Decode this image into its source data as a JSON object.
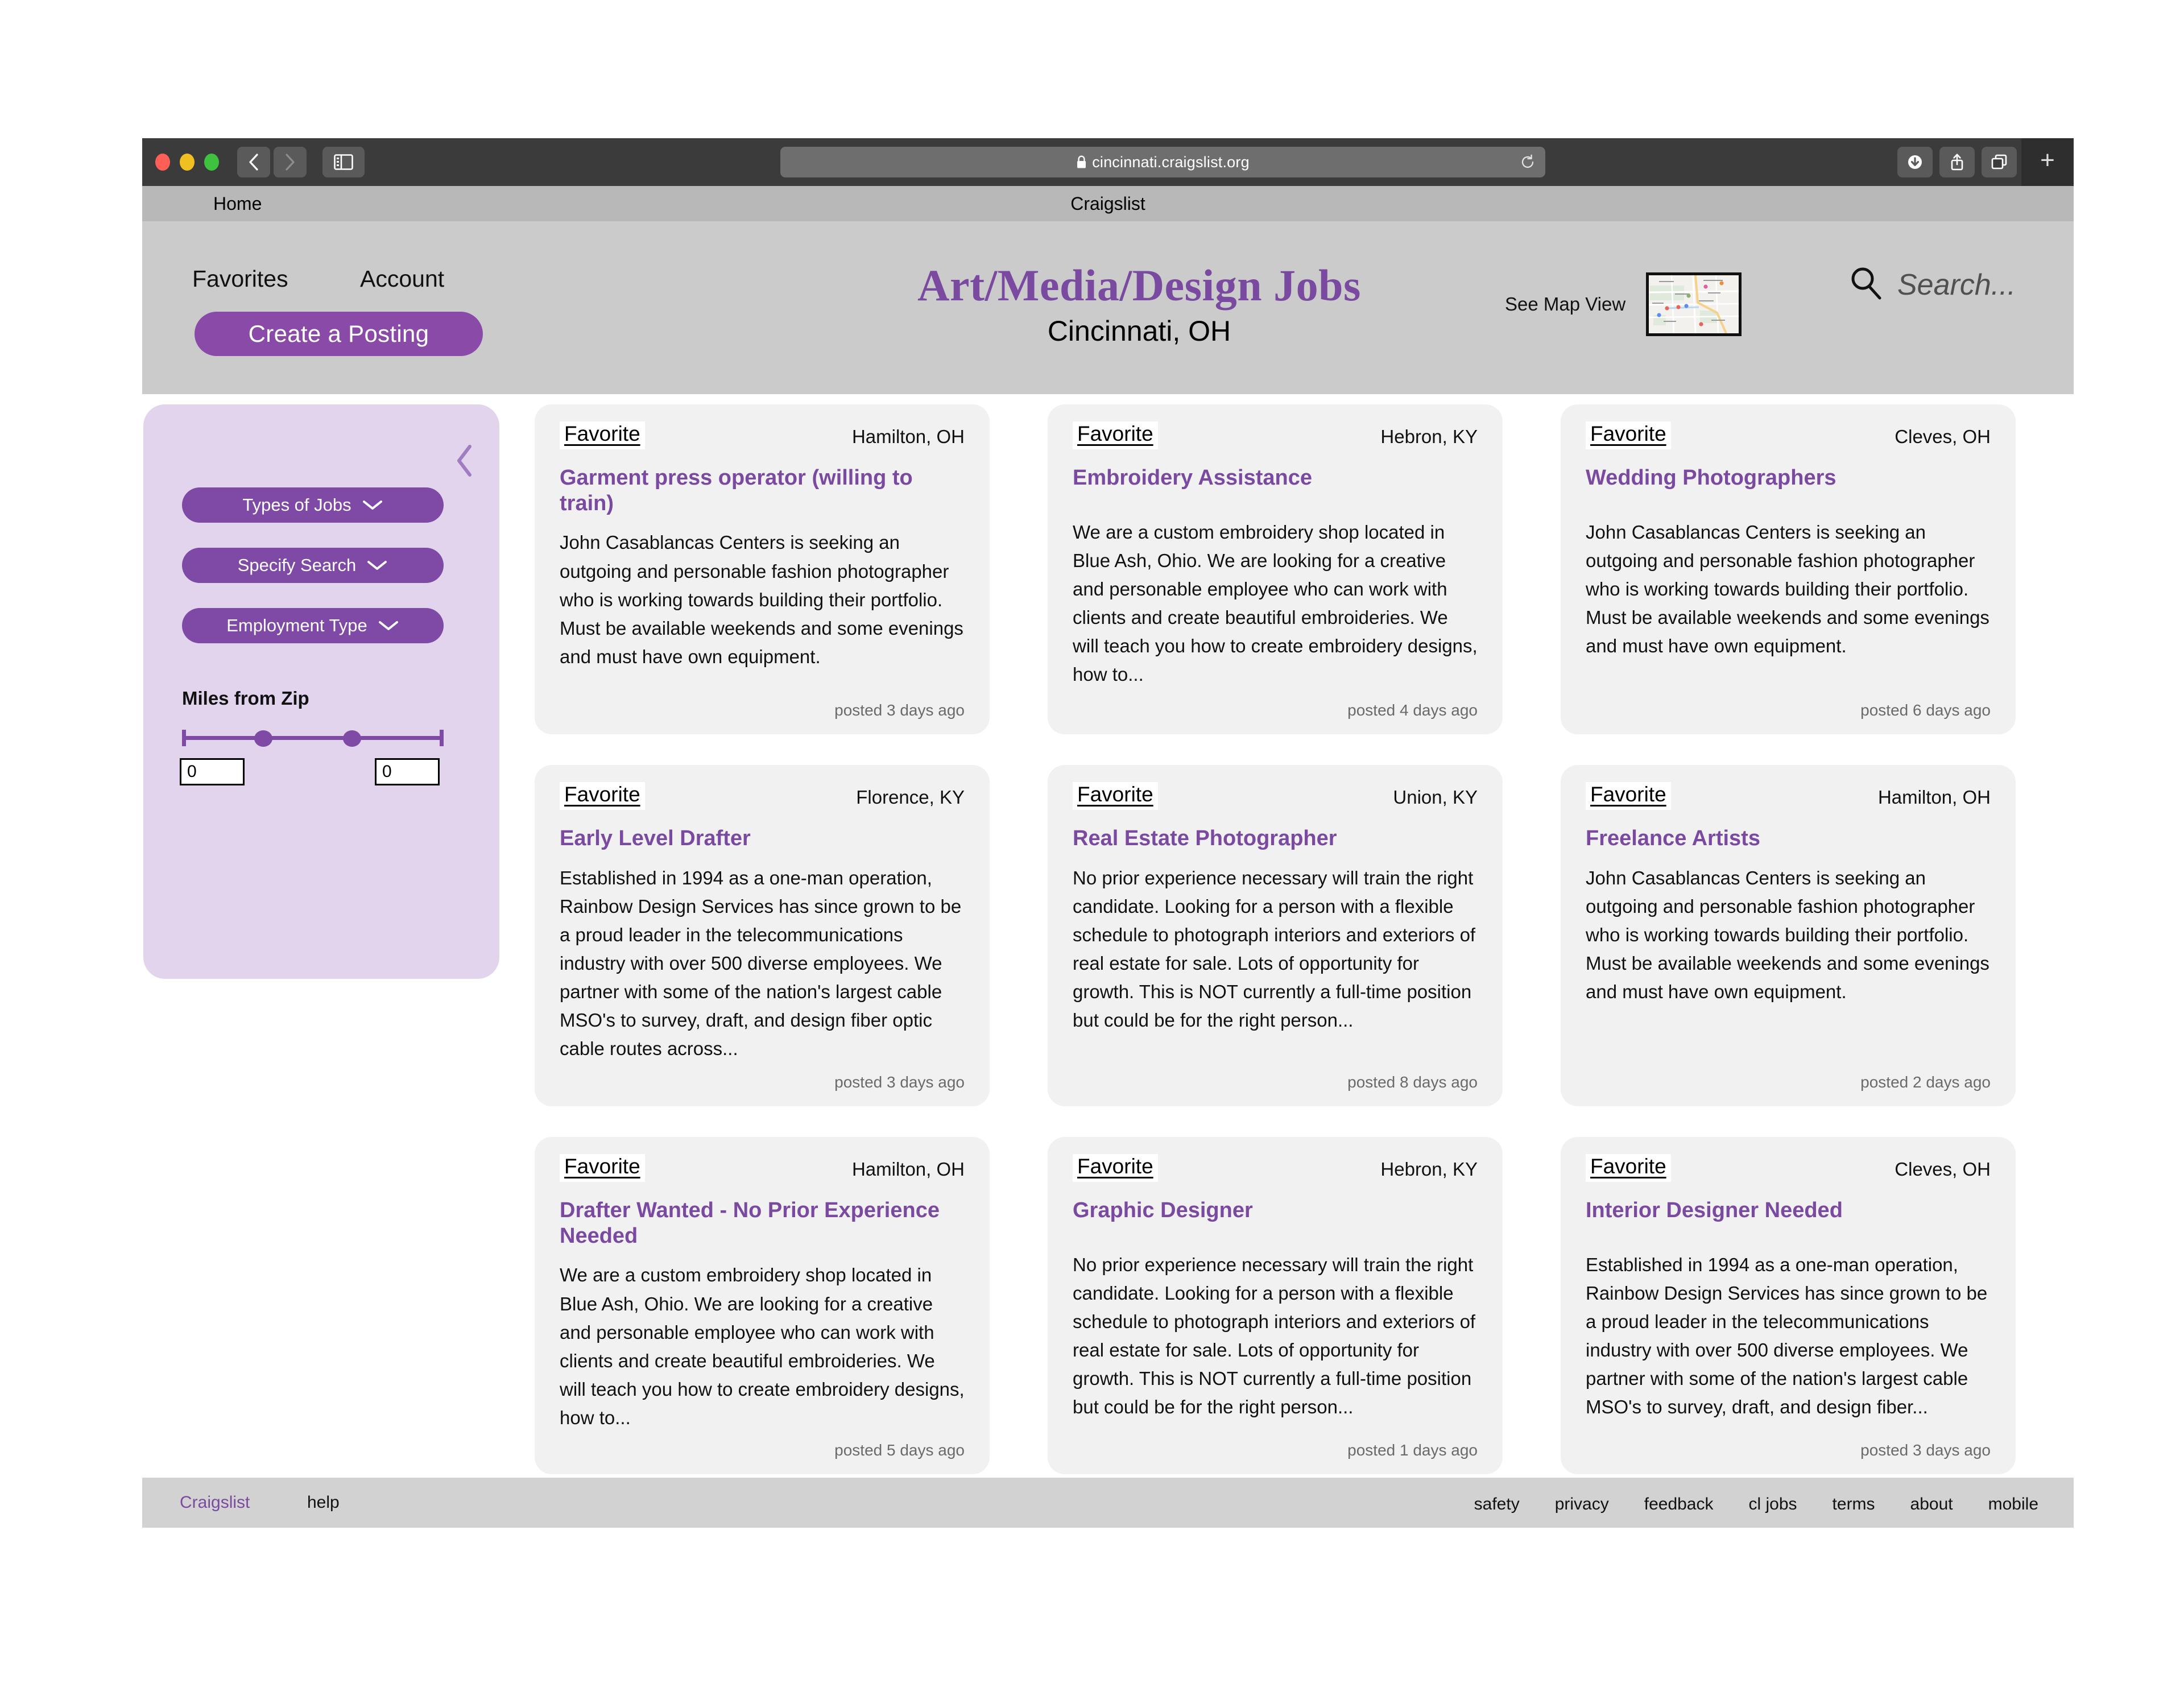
{
  "browser": {
    "url": "cincinnati.craigslist.org",
    "lock_icon": "lock-icon",
    "reload_icon": "reload-icon",
    "back_icon": "chevron-left-icon",
    "forward_icon": "chevron-right-icon",
    "sidebar_icon": "sidebar-toggle-icon",
    "downloads_icon": "download-icon",
    "share_icon": "share-icon",
    "tabs_icon": "tab-overview-icon",
    "new_tab_label": "+"
  },
  "tabbar": {
    "home_label": "Home",
    "active_tab_title": "Craigslist"
  },
  "header": {
    "nav": {
      "favorites": "Favorites",
      "account": "Account"
    },
    "create_posting_label": "Create a Posting",
    "title": "Art/Media/Design Jobs",
    "subtitle": "Cincinnati, OH",
    "map_view_label": "See Map View",
    "map_thumb_icon": "map-thumbnail",
    "search_icon": "search-icon",
    "search_placeholder": "Search...",
    "title_color": "#7a4aa0",
    "accent_color": "#8a4aa8"
  },
  "filters": {
    "collapse_icon": "chevron-left-icon",
    "dropdowns": [
      {
        "label": "Types of Jobs",
        "icon": "chevron-down-icon"
      },
      {
        "label": "Specify Search",
        "icon": "chevron-down-icon"
      },
      {
        "label": "Employment Type",
        "icon": "chevron-down-icon"
      }
    ],
    "miles_label": "Miles from Zip",
    "zip_min_value": "0",
    "zip_max_value": "0"
  },
  "jobs": [
    {
      "favorite_label": "Favorite",
      "location": "Hamilton, OH",
      "title": "Garment press operator (willing to train)",
      "description": "John Casablancas Centers is seeking an outgoing and personable fashion photographer who is working towards building their portfolio. Must be available weekends and some evenings and must have own equipment.",
      "posted": "posted 3 days ago"
    },
    {
      "favorite_label": "Favorite",
      "location": "Hebron, KY",
      "title": "Embroidery Assistance",
      "description": "We are a custom embroidery shop located in Blue Ash, Ohio. We are looking for a creative and personable employee who can work with clients and create beautiful embroideries. We will teach you how to create embroidery designs, how to...",
      "posted": "posted 4 days ago"
    },
    {
      "favorite_label": "Favorite",
      "location": "Cleves, OH",
      "title": "Wedding Photographers",
      "description": "John Casablancas Centers is seeking an outgoing and personable fashion photographer who is working towards building their portfolio. Must be available weekends and some evenings and must have own equipment.",
      "posted": "posted 6 days ago"
    },
    {
      "favorite_label": "Favorite",
      "location": "Florence, KY",
      "title": "Early Level Drafter",
      "description": "Established in 1994 as a one-man operation, Rainbow Design Services has since grown to be a proud leader in the telecommunications industry with over 500 diverse employees. We partner with some of the nation's largest cable MSO's to survey, draft, and design fiber optic cable routes across...",
      "posted": "posted 3 days ago"
    },
    {
      "favorite_label": "Favorite",
      "location": "Union, KY",
      "title": "Real Estate Photographer",
      "description": "No prior experience necessary will train the right candidate. Looking for a person with a flexible schedule to photograph interiors and exteriors of real estate for sale. Lots of opportunity for growth. This is NOT currently a full-time position but could be for the right person...",
      "posted": "posted 8 days ago"
    },
    {
      "favorite_label": "Favorite",
      "location": "Hamilton, OH",
      "title": "Freelance Artists",
      "description": "John Casablancas Centers is seeking an outgoing and personable fashion photographer who is working towards building their portfolio. Must be available weekends and some evenings and must have own equipment.",
      "posted": "posted 2 days ago"
    },
    {
      "favorite_label": "Favorite",
      "location": "Hamilton, OH",
      "title": "Drafter Wanted - No Prior Experience Needed",
      "description": "We are a custom embroidery shop located in Blue Ash, Ohio. We are looking for a creative and personable employee who can work with clients and create beautiful embroideries. We will teach you how to create embroidery designs, how to...",
      "posted": "posted 5 days ago"
    },
    {
      "favorite_label": "Favorite",
      "location": "Hebron, KY",
      "title": "Graphic Designer",
      "description": "No prior experience necessary will train the right candidate. Looking for a person with a flexible schedule to photograph interiors and exteriors of real estate for sale. Lots of opportunity for growth. This is NOT currently a full-time position but could be for the right person...",
      "posted": "posted 1 days ago"
    },
    {
      "favorite_label": "Favorite",
      "location": "Cleves, OH",
      "title": "Interior Designer Needed",
      "description": "Established in 1994 as a one-man operation, Rainbow Design Services has since grown to be a proud leader in the telecommunications industry with over 500 diverse employees. We partner with some of the nation's largest cable MSO's to survey, draft, and design fiber...",
      "posted": "posted 3 days ago"
    }
  ],
  "footer": {
    "brand": "Craigslist",
    "help": "help",
    "links": [
      "safety",
      "privacy",
      "feedback",
      "cl jobs",
      "terms",
      "about",
      "mobile"
    ]
  }
}
